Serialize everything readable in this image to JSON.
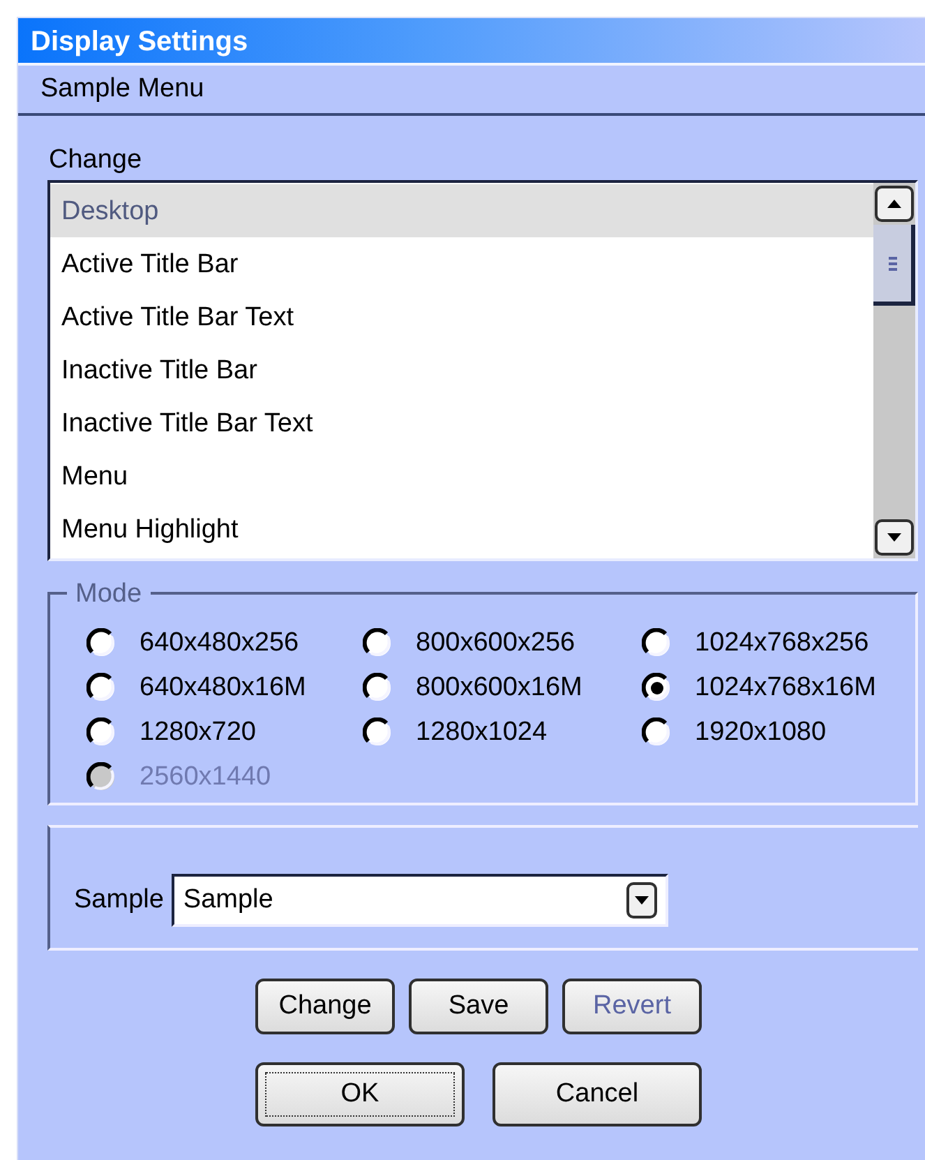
{
  "window": {
    "title": "Display Settings"
  },
  "menu": [
    {
      "label": "Sample Menu"
    }
  ],
  "change_list": {
    "label": "Change",
    "items": [
      {
        "label": "Desktop",
        "selected": true
      },
      {
        "label": "Active Title Bar",
        "selected": false
      },
      {
        "label": "Active Title Bar Text",
        "selected": false
      },
      {
        "label": "Inactive Title Bar",
        "selected": false
      },
      {
        "label": "Inactive Title Bar Text",
        "selected": false
      },
      {
        "label": "Menu",
        "selected": false
      },
      {
        "label": "Menu Highlight",
        "selected": false
      }
    ]
  },
  "mode": {
    "title": "Mode",
    "options": [
      {
        "label": "640x480x256",
        "selected": false,
        "disabled": false
      },
      {
        "label": "800x600x256",
        "selected": false,
        "disabled": false
      },
      {
        "label": "1024x768x256",
        "selected": false,
        "disabled": false
      },
      {
        "label": "640x480x16M",
        "selected": false,
        "disabled": false
      },
      {
        "label": "800x600x16M",
        "selected": false,
        "disabled": false
      },
      {
        "label": "1024x768x16M",
        "selected": true,
        "disabled": false
      },
      {
        "label": "1280x720",
        "selected": false,
        "disabled": false
      },
      {
        "label": "1280x1024",
        "selected": false,
        "disabled": false
      },
      {
        "label": "1920x1080",
        "selected": false,
        "disabled": false
      },
      {
        "label": "2560x1440",
        "selected": false,
        "disabled": true
      }
    ]
  },
  "sample": {
    "label": "Sample",
    "value": "Sample"
  },
  "buttons": [
    {
      "label": "Change",
      "disabled": false
    },
    {
      "label": "Save",
      "disabled": false
    },
    {
      "label": "Revert",
      "disabled": true
    }
  ],
  "dialog_buttons": [
    {
      "label": "OK",
      "disabled": false,
      "default": true
    },
    {
      "label": "Cancel",
      "disabled": false,
      "default": false
    }
  ]
}
